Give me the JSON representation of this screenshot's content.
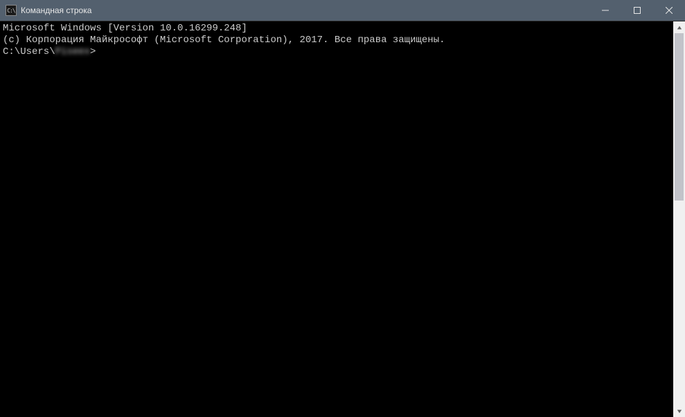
{
  "window": {
    "title": "Командная строка",
    "icon_label": "C:\\"
  },
  "terminal": {
    "line1": "Microsoft Windows [Version 10.0.16299.248]",
    "line2": "(c) Корпорация Майкрософт (Microsoft Corporation), 2017. Все права защищены.",
    "blank": "",
    "prompt_prefix": "C:\\Users\\",
    "prompt_user": "Piseex",
    "prompt_suffix": ">"
  }
}
